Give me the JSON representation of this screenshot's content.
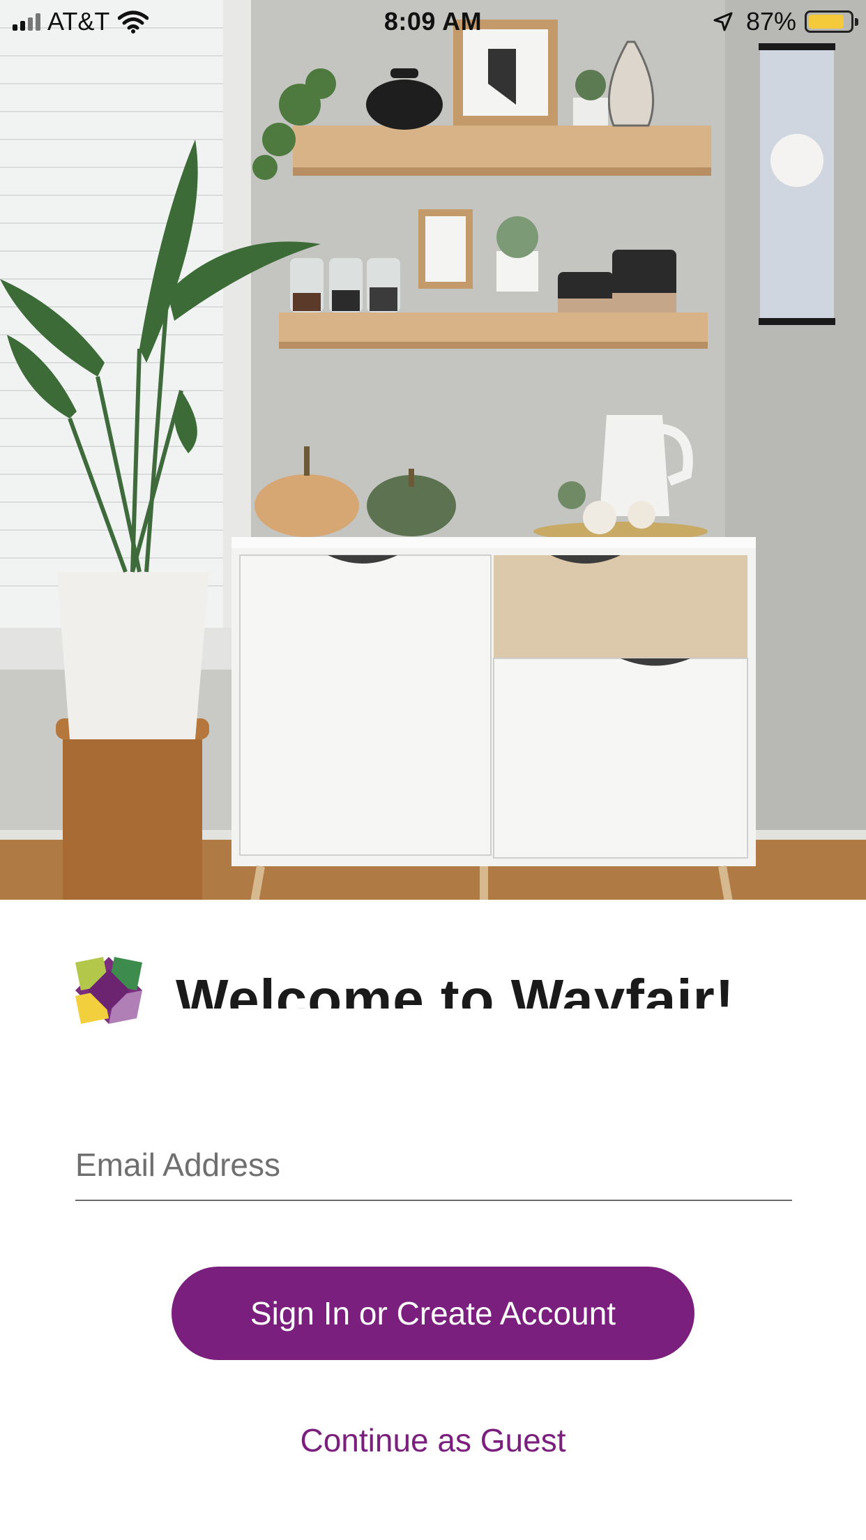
{
  "status_bar": {
    "carrier": "AT&T",
    "time": "8:09 AM",
    "battery": "87%",
    "battery_level": 0.87,
    "icons": [
      "signal-icon",
      "wifi-icon",
      "location-arrow-icon",
      "battery-icon"
    ]
  },
  "hero": {
    "icon": "photo-illustration"
  },
  "brand": {
    "logo_icon": "wayfair-logo-icon",
    "welcome": "Welcome to Wayfair!"
  },
  "form": {
    "email_placeholder": "Email Address",
    "email_value": "",
    "primary_button": "Sign In or Create Account",
    "guest_link": "Continue as Guest"
  },
  "colors": {
    "accent": "#7b1f7e",
    "logo_green": "#b3c84b",
    "logo_yellow": "#f2cf3d",
    "logo_purple": "#7b2d7e",
    "logo_light_purple": "#b07fb6"
  }
}
